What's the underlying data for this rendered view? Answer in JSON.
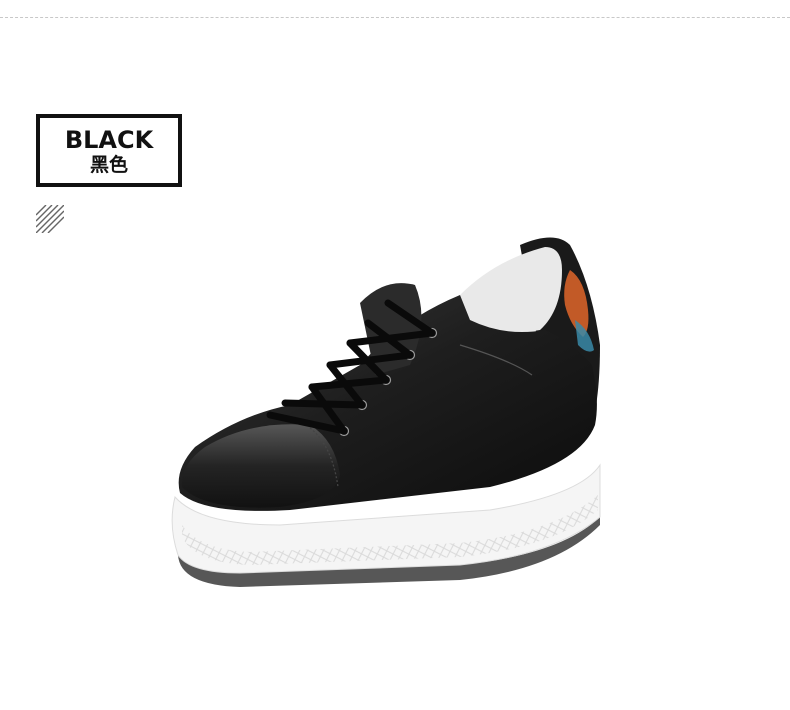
{
  "color_label": {
    "english": "BLACK",
    "chinese": "黑色"
  },
  "colors": {
    "upper": "#1a1a1a",
    "sole": "#f4f4f4",
    "outsole": "#555555",
    "lining": "#e9e9e9",
    "embroidery_orange": "#e0662a",
    "embroidery_teal": "#3a8aa8"
  }
}
